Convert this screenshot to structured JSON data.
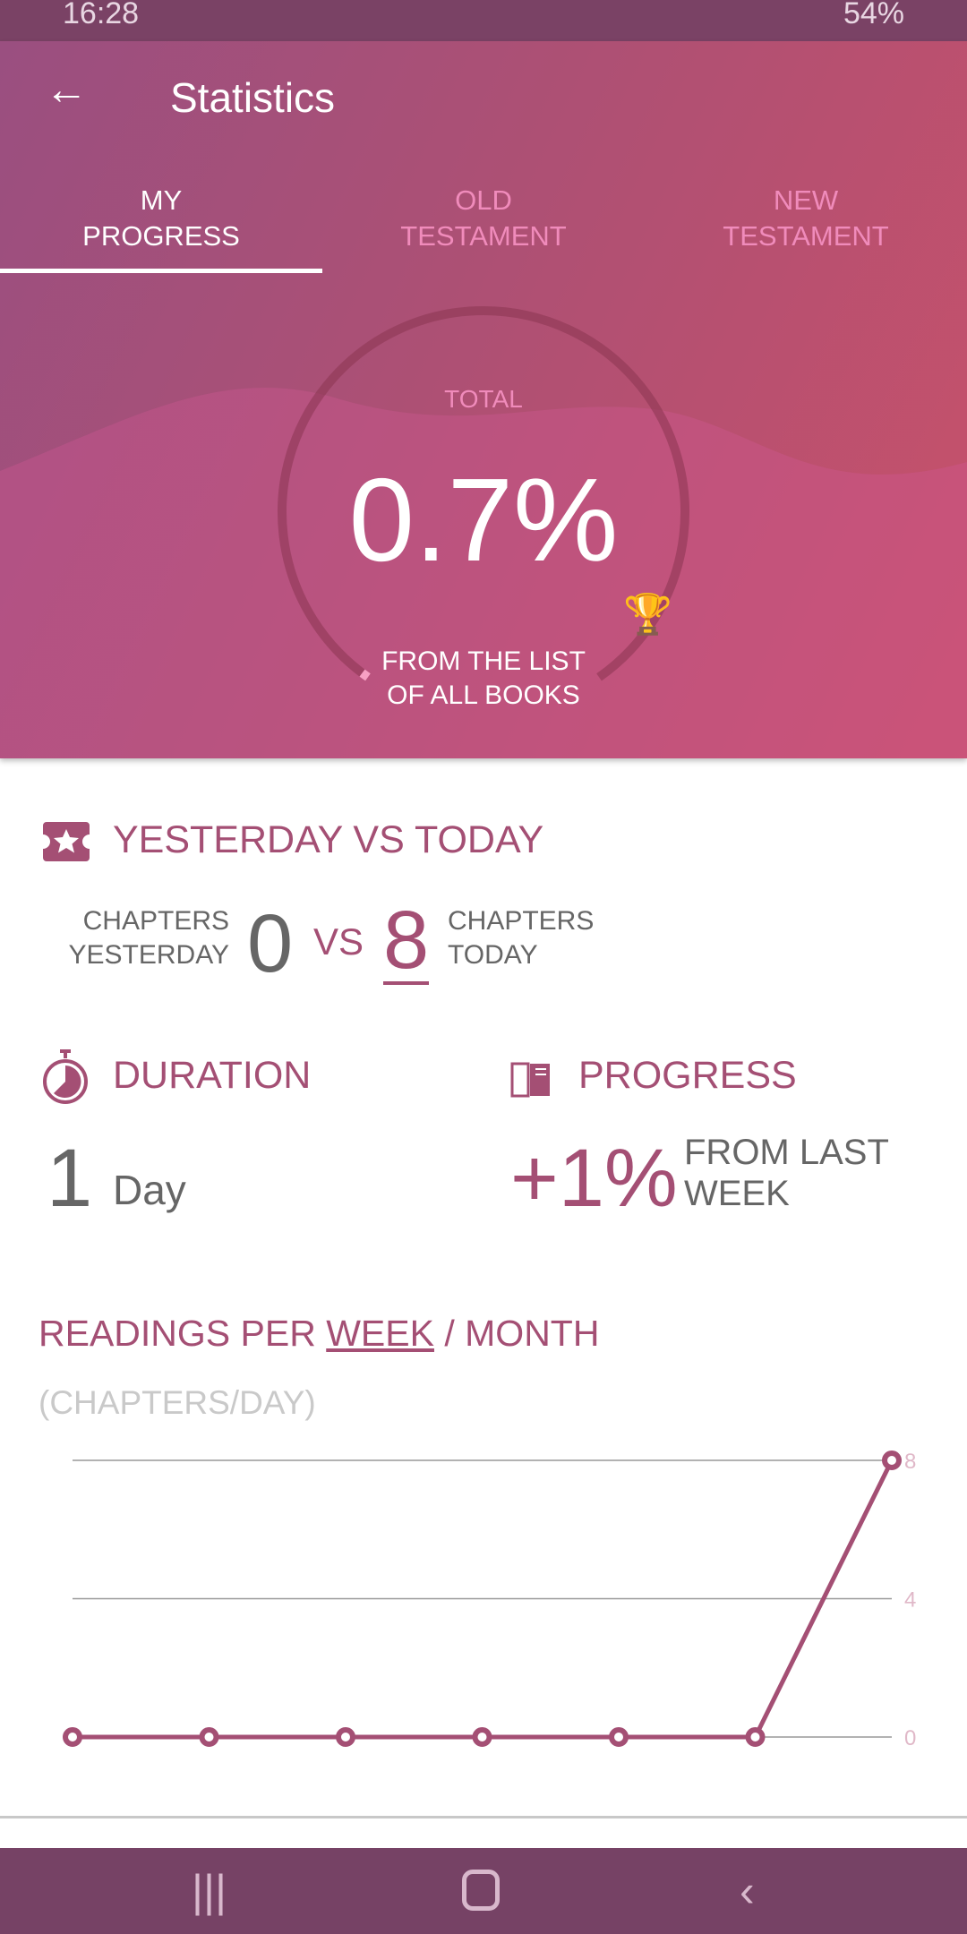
{
  "status_bar": {
    "time": "16:28",
    "battery": "54%"
  },
  "header": {
    "title": "Statistics",
    "back_icon": "arrow-left-icon"
  },
  "tabs": [
    {
      "line1": "MY",
      "line2": "PROGRESS",
      "active": true
    },
    {
      "line1": "OLD",
      "line2": "TESTAMENT",
      "active": false
    },
    {
      "line1": "NEW",
      "line2": "TESTAMENT",
      "active": false
    }
  ],
  "total": {
    "label": "TOTAL",
    "value": "0.7%",
    "progress_percent": 0.7,
    "line1": "FROM THE LIST",
    "line2": "OF ALL BOOKS"
  },
  "yesterday_vs_today": {
    "title": "YESTERDAY VS TODAY",
    "left_l1": "CHAPTERS",
    "left_l2": "YESTERDAY",
    "yesterday": "0",
    "vs": "VS",
    "today": "8",
    "right_l1": "CHAPTERS",
    "right_l2": "TODAY"
  },
  "duration": {
    "title": "DURATION",
    "value": "1",
    "unit": "Day"
  },
  "progress": {
    "title": "PROGRESS",
    "value": "+1%",
    "l1": "FROM LAST",
    "l2": "WEEK"
  },
  "readings": {
    "title_a": "READINGS PER ",
    "title_week": "WEEK",
    "title_b": " / MONTH",
    "subtitle": "(CHAPTERS/DAY)"
  },
  "colors": {
    "accent": "#a44f74",
    "nav": "#764265"
  },
  "chart_data": {
    "type": "line",
    "values": [
      0,
      0,
      0,
      0,
      0,
      0,
      8
    ],
    "yticks": [
      "0",
      "4",
      "8"
    ],
    "ylim": [
      0,
      8
    ],
    "grid": true
  }
}
